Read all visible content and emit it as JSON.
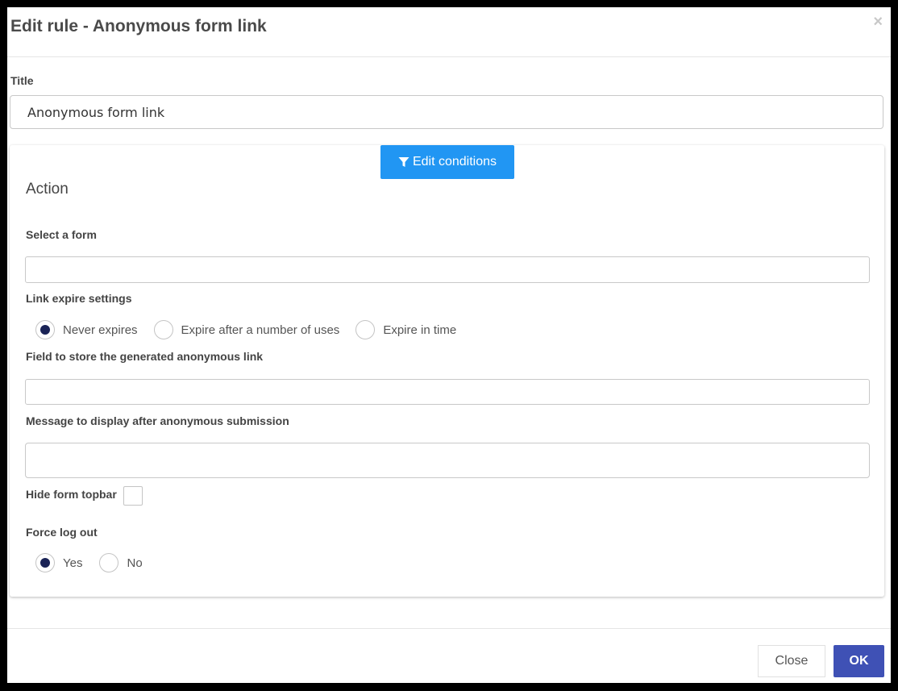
{
  "modal": {
    "title": "Edit rule - Anonymous form link",
    "close_glyph": "×"
  },
  "title_field": {
    "label": "Title",
    "value": "Anonymous form link"
  },
  "conditions_button": {
    "label": "Edit conditions",
    "icon": "filter-icon",
    "color": "#2196f3"
  },
  "action": {
    "heading": "Action",
    "select_form": {
      "label": "Select a form",
      "value": ""
    },
    "link_expire": {
      "label": "Link expire settings",
      "options": [
        {
          "label": "Never expires",
          "selected": true
        },
        {
          "label": "Expire after a number of uses",
          "selected": false
        },
        {
          "label": "Expire in time",
          "selected": false
        }
      ]
    },
    "store_field": {
      "label": "Field to store the generated anonymous link",
      "value": ""
    },
    "message": {
      "label": "Message to display after anonymous submission",
      "value": ""
    },
    "hide_topbar": {
      "label": "Hide form topbar",
      "checked": false
    },
    "force_logout": {
      "label": "Force log out",
      "options": [
        {
          "label": "Yes",
          "selected": true
        },
        {
          "label": "No",
          "selected": false
        }
      ]
    }
  },
  "footer": {
    "close_label": "Close",
    "ok_label": "OK",
    "ok_color": "#3f51b5"
  },
  "colors": {
    "radio_selected": "#1a2356"
  }
}
